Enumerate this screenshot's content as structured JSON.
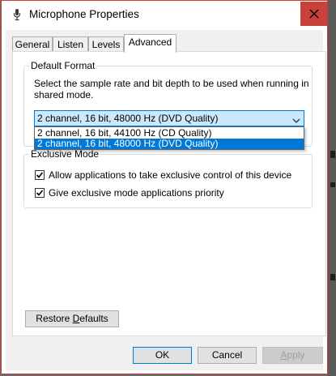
{
  "window": {
    "title": "Microphone Properties"
  },
  "tabs": [
    {
      "label": "General"
    },
    {
      "label": "Listen"
    },
    {
      "label": "Levels"
    },
    {
      "label": "Advanced"
    }
  ],
  "default_format": {
    "legend": "Default Format",
    "description": "Select the sample rate and bit depth to be used when running in shared mode.",
    "selected_value": "2 channel, 16 bit, 48000 Hz (DVD Quality)",
    "options": [
      "2 channel, 16 bit, 44100 Hz (CD Quality)",
      "2 channel, 16 bit, 48000 Hz (DVD Quality)"
    ]
  },
  "exclusive_mode": {
    "legend": "Exclusive Mode",
    "checkboxes": [
      {
        "label": "Allow applications to take exclusive control of this device",
        "checked": true
      },
      {
        "label": "Give exclusive mode applications priority",
        "checked": true
      }
    ]
  },
  "buttons": {
    "restore_prefix": "Restore ",
    "restore_underlined": "D",
    "restore_suffix": "efaults",
    "ok": "OK",
    "cancel": "Cancel",
    "apply_underlined": "A",
    "apply_suffix": "pply"
  },
  "colors": {
    "accent": "#0078d7",
    "close_button": "#c9403a",
    "combo_highlight": "#cce8ff"
  }
}
